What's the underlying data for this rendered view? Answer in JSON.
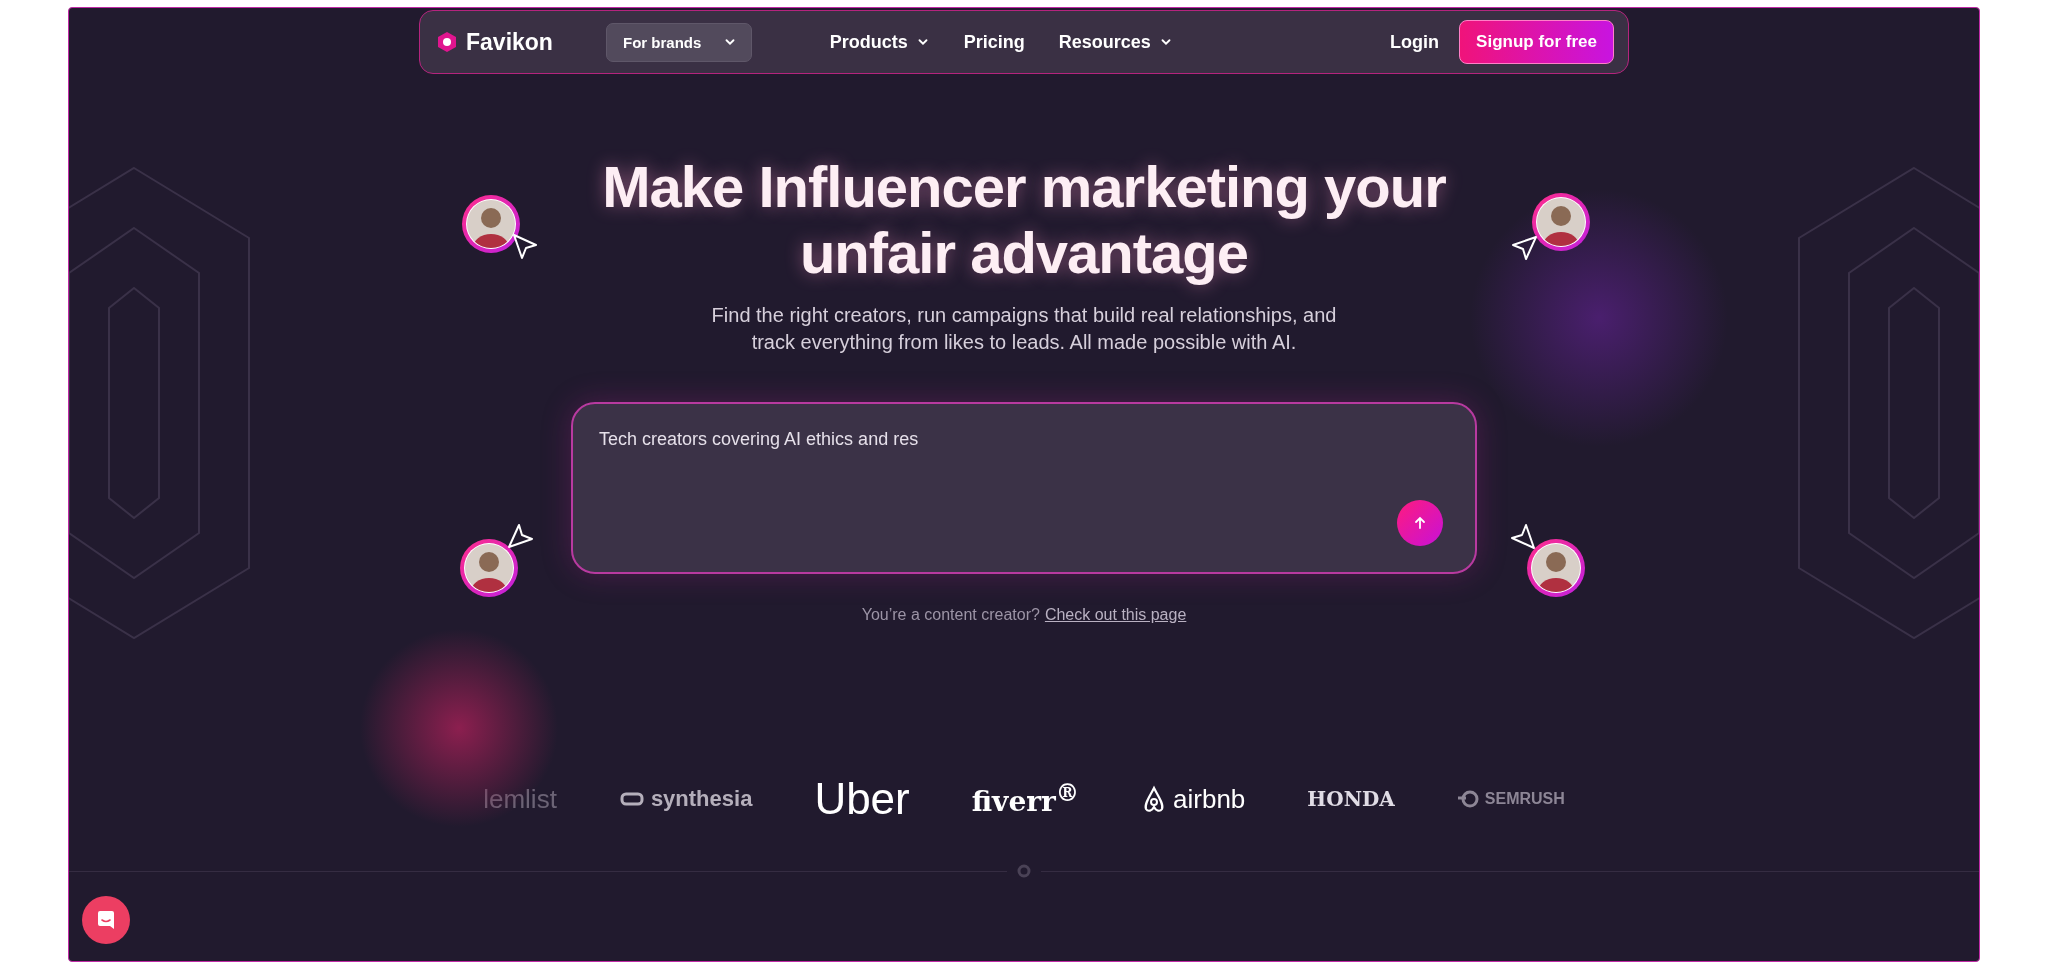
{
  "navbar": {
    "brand": "Favikon",
    "audience_select": "For brands",
    "links": [
      {
        "label": "Products",
        "dropdown": true
      },
      {
        "label": "Pricing",
        "dropdown": false
      },
      {
        "label": "Resources",
        "dropdown": true
      }
    ],
    "login": "Login",
    "signup": "Signup for free"
  },
  "hero": {
    "title_lines": [
      "Make Influencer marketing your",
      "unfair advantage"
    ],
    "subtitle_lines": [
      "Find the right creators, run campaigns that build real relationships, and",
      "track everything from likes to leads. All made possible with AI."
    ]
  },
  "prompt": {
    "value": "Tech creators covering AI ethics and res"
  },
  "creator_note": {
    "text": "You’re a content creator?",
    "link": "Check out this page"
  },
  "logos": [
    {
      "name": "lemlist",
      "kind": "faded"
    },
    {
      "name": "synthesia",
      "kind": "muted"
    },
    {
      "name": "Uber",
      "kind": "uber"
    },
    {
      "name": "fiverr$^{®}$",
      "kind": "fiverr"
    },
    {
      "name": "airbnb",
      "kind": "airbnb"
    },
    {
      "name": "HONDA",
      "kind": "honda"
    },
    {
      "name": "SEMRUSH",
      "kind": "semrush"
    }
  ]
}
